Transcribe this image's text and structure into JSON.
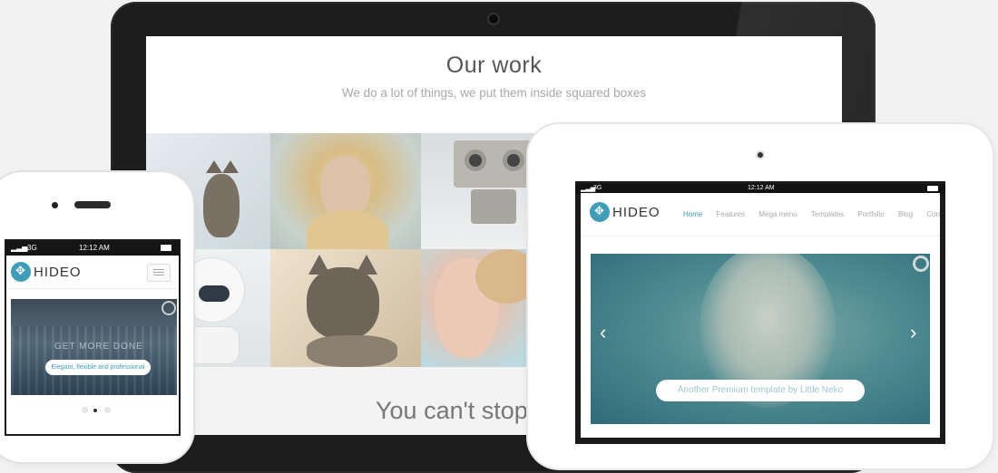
{
  "desktop": {
    "title": "Our work",
    "subtitle": "We do a lot of things, we put them inside squared boxes",
    "section_heading": "You can't stop t"
  },
  "phone": {
    "status": {
      "signal": "3G",
      "time": "12:12 AM"
    },
    "logo_text": "HIDEO",
    "slider": {
      "overlay_text": "GET MORE DONE",
      "pill_text": "Elegant, flexible and professional"
    }
  },
  "tablet": {
    "status": {
      "signal": "3G",
      "time": "12:12 AM"
    },
    "logo_text": "HIDEO",
    "nav": [
      "Home",
      "Features",
      "Mega menu",
      "Templates",
      "Portfolio",
      "Blog",
      "Contact"
    ],
    "slider": {
      "pill_text": "Another Premium template by Little Neko",
      "prev_arrow": "‹",
      "next_arrow": "›"
    }
  },
  "colors": {
    "accent": "#3f9db8",
    "background": "#f2f2f2"
  }
}
